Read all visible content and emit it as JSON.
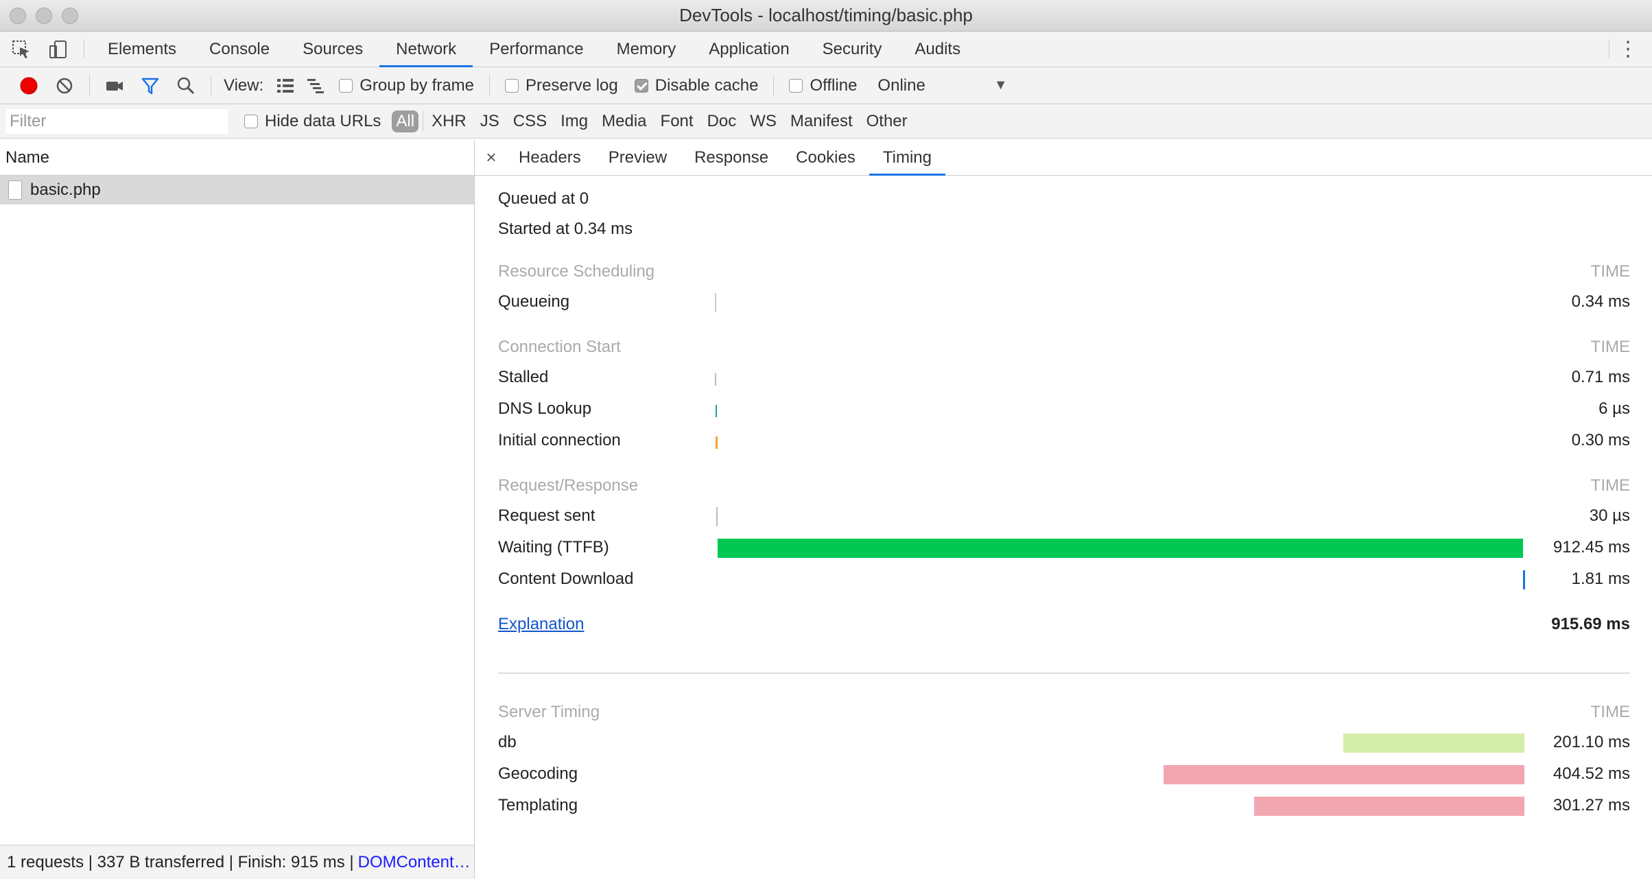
{
  "window": {
    "title": "DevTools - localhost/timing/basic.php"
  },
  "main_tabs": [
    "Elements",
    "Console",
    "Sources",
    "Network",
    "Performance",
    "Memory",
    "Application",
    "Security",
    "Audits"
  ],
  "toolbar": {
    "view_label": "View:",
    "group_by_frame": "Group by frame",
    "preserve_log": "Preserve log",
    "disable_cache": "Disable cache",
    "offline": "Offline",
    "throttle": "Online"
  },
  "filterbar": {
    "placeholder": "Filter",
    "hide_data_urls": "Hide data URLs",
    "types": [
      "All",
      "XHR",
      "JS",
      "CSS",
      "Img",
      "Media",
      "Font",
      "Doc",
      "WS",
      "Manifest",
      "Other"
    ]
  },
  "requests": {
    "header": "Name",
    "rows": [
      "basic.php"
    ],
    "status": {
      "summary": "1 requests | 337 B transferred | Finish: 915 ms | ",
      "link": "DOMContent…"
    }
  },
  "detail_tabs": {
    "close": "×",
    "tabs": [
      "Headers",
      "Preview",
      "Response",
      "Cookies",
      "Timing"
    ]
  },
  "timing": {
    "queued_at": "Queued at 0",
    "started_at": "Started at 0.34 ms",
    "time_header": "TIME",
    "resource_scheduling": {
      "title": "Resource Scheduling",
      "rows": [
        {
          "label": "Queueing",
          "value": "0.34 ms",
          "color": "#cccccc"
        }
      ]
    },
    "connection_start": {
      "title": "Connection Start",
      "rows": [
        {
          "label": "Stalled",
          "value": "0.71 ms",
          "color": "#bbbbbb"
        },
        {
          "label": "DNS Lookup",
          "value": "6 µs",
          "color": "#1f9e9e"
        },
        {
          "label": "Initial connection",
          "value": "0.30 ms",
          "color": "#f5a623"
        }
      ]
    },
    "request_response": {
      "title": "Request/Response",
      "rows": [
        {
          "label": "Request sent",
          "value": "30 µs",
          "color": "#bbbbbb"
        },
        {
          "label": "Waiting (TTFB)",
          "value": "912.45 ms",
          "color": "#00c853"
        },
        {
          "label": "Content Download",
          "value": "1.81 ms",
          "color": "#1a73e8"
        }
      ]
    },
    "explanation": "Explanation",
    "total": "915.69 ms",
    "server_timing": {
      "title": "Server Timing",
      "rows": [
        {
          "label": "db",
          "value": "201.10 ms",
          "color": "#d4edaa"
        },
        {
          "label": "Geocoding",
          "value": "404.52 ms",
          "color": "#f2a7b0"
        },
        {
          "label": "Templating",
          "value": "301.27 ms",
          "color": "#f2a7b0"
        }
      ]
    }
  }
}
